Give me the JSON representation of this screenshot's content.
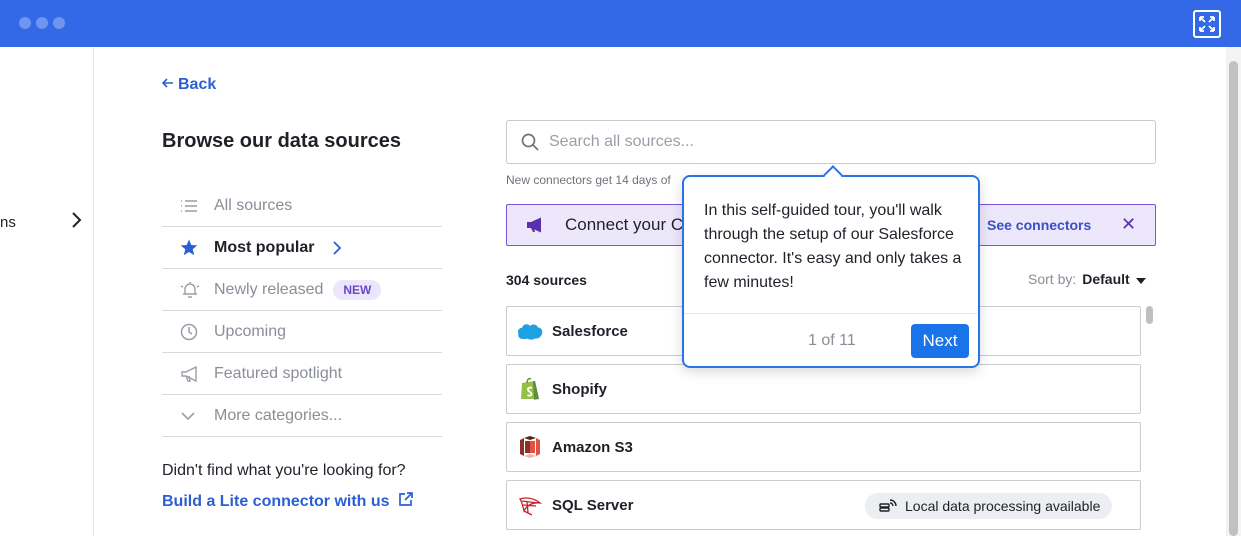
{
  "window": {
    "accent": "#3369e7"
  },
  "sidebar": {
    "fragment_label": "ns"
  },
  "nav": {
    "back_label": "Back"
  },
  "page": {
    "title": "Browse our data sources"
  },
  "categories": [
    {
      "label": "All sources",
      "icon": "list-icon"
    },
    {
      "label": "Most popular",
      "icon": "star-icon",
      "active": true
    },
    {
      "label": "Newly released",
      "icon": "bell-icon",
      "badge": "NEW"
    },
    {
      "label": "Upcoming",
      "icon": "clock-icon"
    },
    {
      "label": "Featured spotlight",
      "icon": "megaphone-icon"
    },
    {
      "label": "More categories...",
      "icon": "chevron-down-icon"
    }
  ],
  "footer_help": {
    "question": "Didn't find what you're looking for?",
    "link": "Build a Lite connector with us"
  },
  "search": {
    "placeholder": "Search all sources...",
    "note": "New connectors get 14 days of"
  },
  "banner": {
    "text": "Connect your C",
    "link": "See connectors",
    "close": "✕"
  },
  "results": {
    "count": "304 sources",
    "sort_label": "Sort by:",
    "sort_value": "Default"
  },
  "sources": [
    {
      "name": "Salesforce",
      "icon": "salesforce-logo"
    },
    {
      "name": "Shopify",
      "icon": "shopify-logo"
    },
    {
      "name": "Amazon S3",
      "icon": "amazon-s3-logo"
    },
    {
      "name": "SQL Server",
      "icon": "sql-server-logo",
      "tag": "Local data processing available"
    }
  ],
  "tour": {
    "text": "In this self-guided tour, you'll walk through the setup of our Salesforce connector. It's easy and only takes a few minutes!",
    "step": "1 of 11",
    "next_label": "Next"
  }
}
